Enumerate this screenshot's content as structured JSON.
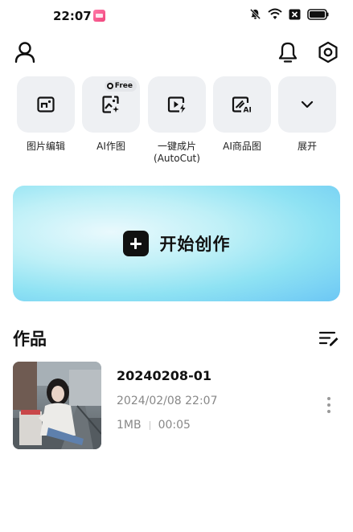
{
  "status_bar": {
    "time": "22:07",
    "notification_app_icon": "app-notification-icon",
    "icons": [
      "mute-icon",
      "wifi-icon",
      "sim-off-icon",
      "battery-icon"
    ]
  },
  "top_bar": {
    "left_icon": "profile-icon",
    "right_icons": [
      "bell-icon",
      "settings-icon"
    ]
  },
  "quick_actions": [
    {
      "label": "图片编辑",
      "icon": "image-edit-icon"
    },
    {
      "label": "AI作图",
      "icon": "ai-image-icon",
      "badge": "Free"
    },
    {
      "label": "一键成片\n(AutoCut)",
      "icon": "autocut-icon"
    },
    {
      "label": "AI商品图",
      "icon": "ai-product-icon"
    },
    {
      "label": "展开",
      "icon": "chevron-down-icon"
    }
  ],
  "create_banner": {
    "label": "开始创作",
    "icon": "plus-icon",
    "gradient_colors": [
      "#e9f9fd",
      "#8ee2f3",
      "#6cc7f4"
    ]
  },
  "works": {
    "title": "作品",
    "items": [
      {
        "name": "20240208-01",
        "date": "2024/02/08 22:07",
        "size": "1MB",
        "duration": "00:05"
      }
    ]
  },
  "colors": {
    "tile_bg": "#eef0f3",
    "text_primary": "#111111",
    "text_secondary": "#888888"
  }
}
